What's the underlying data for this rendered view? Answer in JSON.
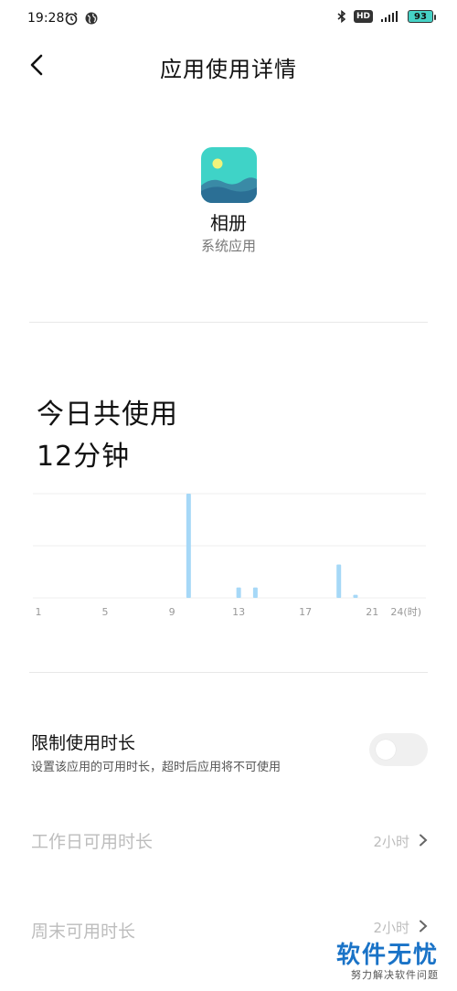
{
  "status_bar": {
    "time": "19:28",
    "hd": "HD",
    "battery": "93",
    "icons": [
      "alarm-icon",
      "globe-icon",
      "bluetooth-icon",
      "signal-icon"
    ]
  },
  "header": {
    "title": "应用使用详情"
  },
  "app": {
    "name": "相册",
    "subtitle": "系统应用",
    "icon": "gallery-icon"
  },
  "usage": {
    "label": "今日共使用",
    "value": "12分钟"
  },
  "chart_data": {
    "type": "bar",
    "x_tick_labels": [
      "1",
      "5",
      "9",
      "13",
      "17",
      "21",
      "24(时)"
    ],
    "x": [
      10,
      13,
      14,
      19,
      20
    ],
    "values": [
      10,
      1,
      1,
      3.2,
      0.3
    ],
    "xlim": [
      1,
      24
    ],
    "ylim": [
      0,
      10
    ],
    "grid": true,
    "bar_color": "#a6d8f7"
  },
  "limit": {
    "title": "限制使用时长",
    "description": "设置该应用的可用时长，超时后应用将不可使用",
    "enabled": false
  },
  "rows": [
    {
      "label": "工作日可用时长",
      "value": "2小时"
    },
    {
      "label": "周末可用时长",
      "value": "2小时"
    }
  ],
  "watermark": {
    "logo": "软件无忧",
    "subtitle": "努力解决软件问题"
  }
}
